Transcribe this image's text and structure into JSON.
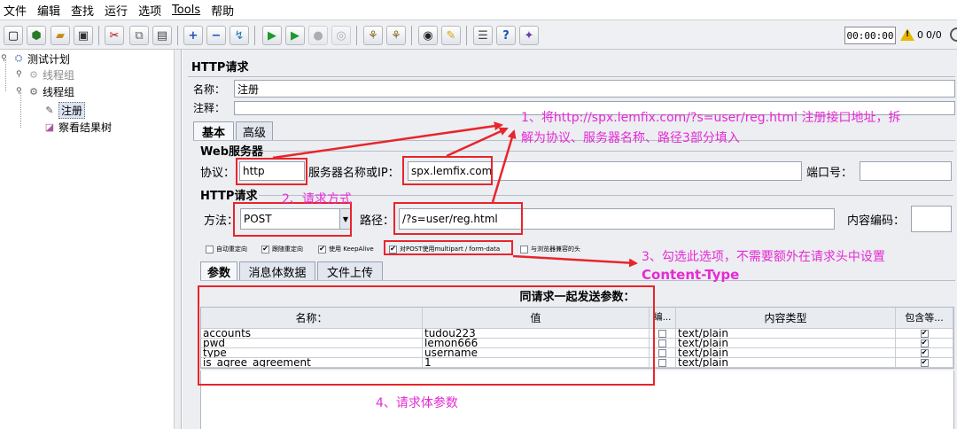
{
  "menu": [
    "文件",
    "编辑",
    "查找",
    "运行",
    "选项",
    "Tools",
    "帮助"
  ],
  "toolbar": {
    "icons": [
      "new-icon",
      "templates-icon",
      "open-icon",
      "save-icon",
      "cut-icon",
      "copy-icon",
      "paste-icon",
      "expand-icon",
      "collapse-icon",
      "toggle-icon",
      "start-icon",
      "start-no-pause-icon",
      "stop-icon",
      "shutdown-icon",
      "clear-icon",
      "clear-all-icon",
      "search-icon",
      "reset-search-icon",
      "function-helper-icon",
      "help-icon",
      "remote-icon"
    ],
    "timer": "00:00:00",
    "warning_count": "0",
    "threads": "0/0"
  },
  "tree": {
    "test_plan": "测试计划",
    "thread_group_1": "线程组",
    "thread_group_2": "线程组",
    "register": "注册",
    "results_tree": "察看结果树"
  },
  "panel": {
    "title": "HTTP请求",
    "name_label": "名称：",
    "name_value": "注册",
    "comment_label": "注释：",
    "tabs": [
      "基本",
      "高级"
    ],
    "web_server_legend": "Web服务器",
    "protocol_label": "协议：",
    "protocol_value": "http",
    "server_label": "服务器名称或IP：",
    "server_value": "spx.lemfix.com",
    "port_label": "端口号：",
    "port_value": "",
    "http_request_legend": "HTTP请求",
    "method_label": "方法：",
    "method_value": "POST",
    "path_label": "路径：",
    "path_value": "/?s=user/reg.html",
    "encoding_label": "内容编码：",
    "encoding_value": "",
    "checkboxes": [
      {
        "label": "自动重定向",
        "checked": false
      },
      {
        "label": "跟随重定向",
        "checked": true
      },
      {
        "label": "使用 KeepAlive",
        "checked": true
      },
      {
        "label": "对POST使用multipart / form-data",
        "checked": true
      },
      {
        "label": "与浏览器兼容的头",
        "checked": false
      }
    ],
    "sub_tabs": [
      "参数",
      "消息体数据",
      "文件上传"
    ],
    "params_caption": "同请求一起发送参数：",
    "columns": [
      "名称：",
      "值",
      "编...",
      "内容类型",
      "包含等..."
    ],
    "rows": [
      {
        "name": "accounts",
        "value": "tudou223",
        "encode": false,
        "content_type": "text/plain",
        "include_equals": true
      },
      {
        "name": "pwd",
        "value": "lemon666",
        "encode": false,
        "content_type": "text/plain",
        "include_equals": true
      },
      {
        "name": "type",
        "value": "username",
        "encode": false,
        "content_type": "text/plain",
        "include_equals": true
      },
      {
        "name": "is_agree_agreement",
        "value": "1",
        "encode": false,
        "content_type": "text/plain",
        "include_equals": true
      }
    ]
  },
  "annotations": {
    "note1_line1": "1、将http://spx.lemfix.com/?s=user/reg.html 注册接口地址，拆",
    "note1_line2": "解为协议、服务器名称、路径3部分填入",
    "note2": "2、请求方式",
    "note3_line1": "3、勾选此选项，不需要额外在请求头中设置",
    "note3_line2": "Content-Type",
    "note4": "4、请求体参数",
    "color_text": "#e62ad4",
    "color_box": "#e8252b"
  }
}
